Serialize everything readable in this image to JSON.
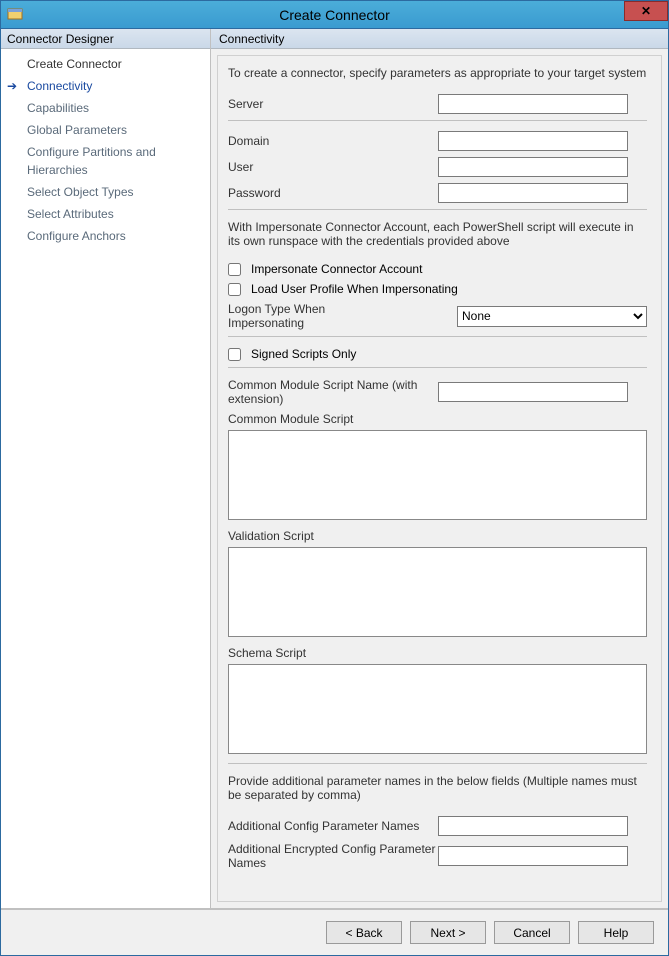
{
  "window": {
    "title": "Create Connector"
  },
  "sidebar": {
    "header": "Connector Designer",
    "items": [
      {
        "label": "Create Connector"
      },
      {
        "label": "Connectivity"
      },
      {
        "label": "Capabilities"
      },
      {
        "label": "Global Parameters"
      },
      {
        "label": "Configure Partitions and Hierarchies"
      },
      {
        "label": "Select Object Types"
      },
      {
        "label": "Select Attributes"
      },
      {
        "label": "Configure Anchors"
      }
    ]
  },
  "content": {
    "header": "Connectivity",
    "intro": "To create a connector, specify parameters as appropriate to your target system",
    "serverLabel": "Server",
    "domainLabel": "Domain",
    "userLabel": "User",
    "passwordLabel": "Password",
    "impersonateDesc": "With Impersonate Connector Account, each PowerShell script will execute in its own runspace with the credentials provided above",
    "impersonateChk": "Impersonate Connector Account",
    "loadProfileChk": "Load User Profile When Impersonating",
    "logonTypeLabel": "Logon Type When Impersonating",
    "logonTypeValue": "None",
    "signedScriptsChk": "Signed Scripts Only",
    "commonModuleNameLabel": "Common Module Script Name (with extension)",
    "commonModuleScriptLabel": "Common Module Script",
    "validationScriptLabel": "Validation Script",
    "schemaScriptLabel": "Schema Script",
    "additionalParamsDesc": "Provide additional parameter names in the below fields (Multiple names must be separated by comma)",
    "additionalConfigLabel": "Additional Config Parameter Names",
    "additionalEncConfigLabel": "Additional Encrypted Config Parameter Names"
  },
  "footer": {
    "back": "<  Back",
    "next": "Next  >",
    "cancel": "Cancel",
    "help": "Help"
  }
}
